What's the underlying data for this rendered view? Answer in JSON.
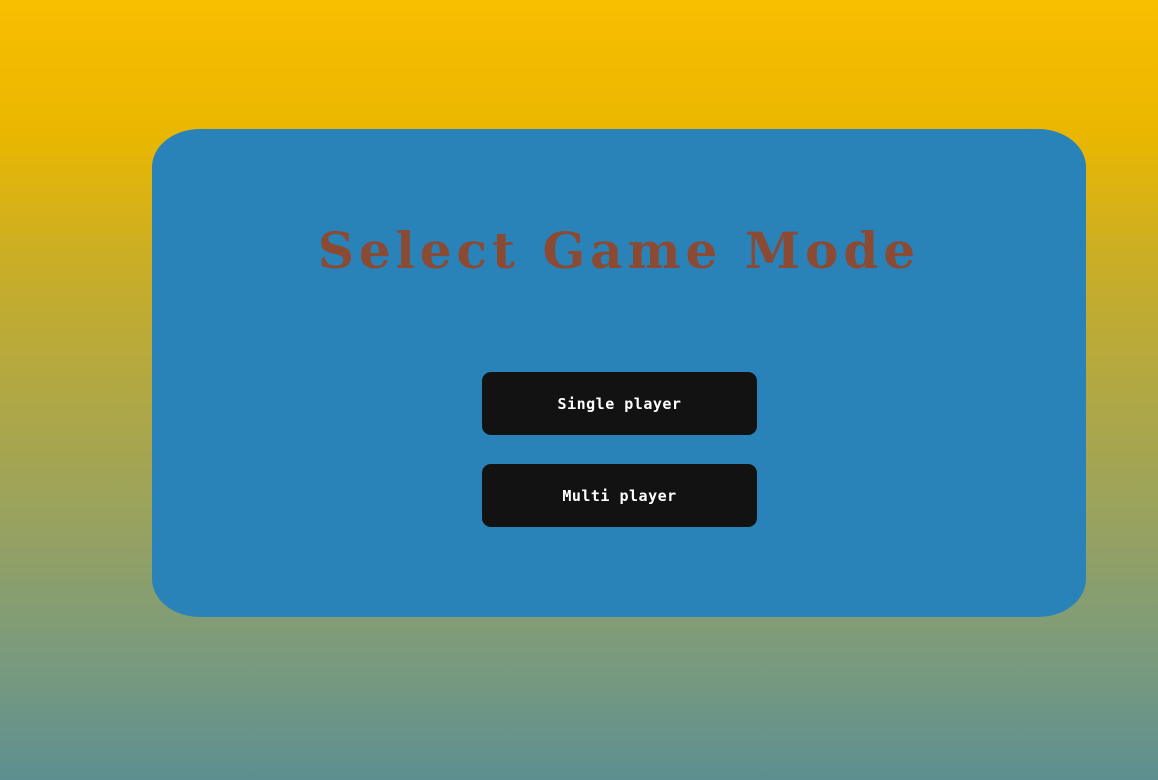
{
  "menu": {
    "title": "Select Game Mode",
    "buttons": {
      "single_label": "Single player",
      "multi_label": "Multi player"
    }
  },
  "colors": {
    "background_top": "#f9be00",
    "background_bottom": "#5d8f91",
    "panel": "#2a83b8",
    "title": "#8a4a34",
    "button": "#121212",
    "button_text": "#ffffff"
  }
}
